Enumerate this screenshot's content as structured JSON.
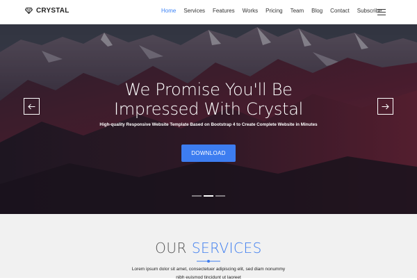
{
  "brand": {
    "name": "CRYSTAL",
    "icon": "diamond-icon"
  },
  "nav": {
    "items": [
      {
        "label": "Home",
        "active": true
      },
      {
        "label": "Services",
        "active": false
      },
      {
        "label": "Features",
        "active": false
      },
      {
        "label": "Works",
        "active": false
      },
      {
        "label": "Pricing",
        "active": false
      },
      {
        "label": "Team",
        "active": false
      },
      {
        "label": "Blog",
        "active": false
      },
      {
        "label": "Contact",
        "active": false
      },
      {
        "label": "Subscribe",
        "active": false
      }
    ],
    "menu_icon": "hamburger-icon"
  },
  "hero": {
    "title_line1": "We Promise You'll Be",
    "title_line2": "Impressed With Crystal",
    "subtitle": "High-quality Responsive Website Template Based on Bootstrap 4 to Create Complete Website in Minutes",
    "button_label": "DOWNLOAD",
    "prev_icon": "arrow-left-icon",
    "next_icon": "arrow-right-icon",
    "slide_count": 3,
    "active_slide": 2
  },
  "services": {
    "title_part1": "OUR ",
    "title_part2": "SERVICES",
    "text_line1": "Lorem ipsum dolor sit amet, consectetuer adipiscing elit, sed diam nonummy",
    "text_line2": "nibh euismod tincidunt ut laoreet"
  },
  "colors": {
    "accent": "#3d7df0",
    "nav_active": "#3b82f6",
    "services_bg": "#f1f1f1"
  }
}
